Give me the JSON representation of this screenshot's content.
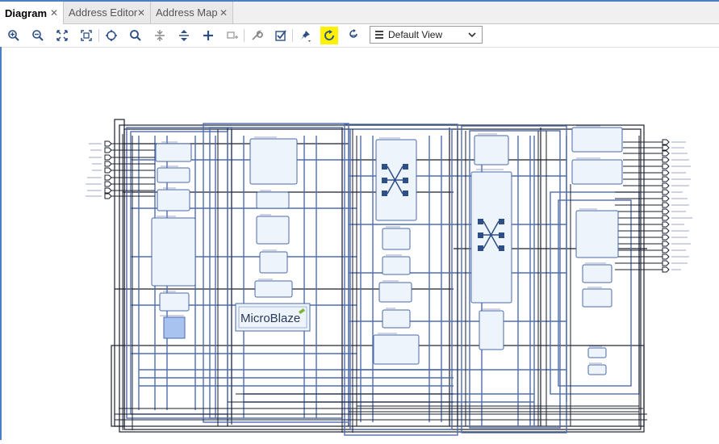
{
  "tabs": [
    {
      "label": "Diagram",
      "active": true
    },
    {
      "label": "Address Editor",
      "active": false
    },
    {
      "label": "Address Map",
      "active": false
    }
  ],
  "toolbar": {
    "icons": [
      "zoom-in-icon",
      "zoom-out-icon",
      "fit-to-window-icon",
      "zoom-fit-selection-icon",
      "auto-connect-icon",
      "search-icon",
      "collapse-icon",
      "expand-icon",
      "add-ip-icon",
      "add-module-icon",
      "validate-icon",
      "settings-icon",
      "pin-icon",
      "regenerate-layout-icon",
      "optimize-routing-icon"
    ],
    "highlight_color": "#fff200",
    "view_select": {
      "value": "Default View"
    }
  },
  "diagram": {
    "main_label": "MicroBlaze",
    "accent_wire_color": "#4f6db0",
    "dark_wire_color": "#1a1f2e",
    "block_fill": "#eef4fc",
    "block_border": "#4a6aa8"
  }
}
